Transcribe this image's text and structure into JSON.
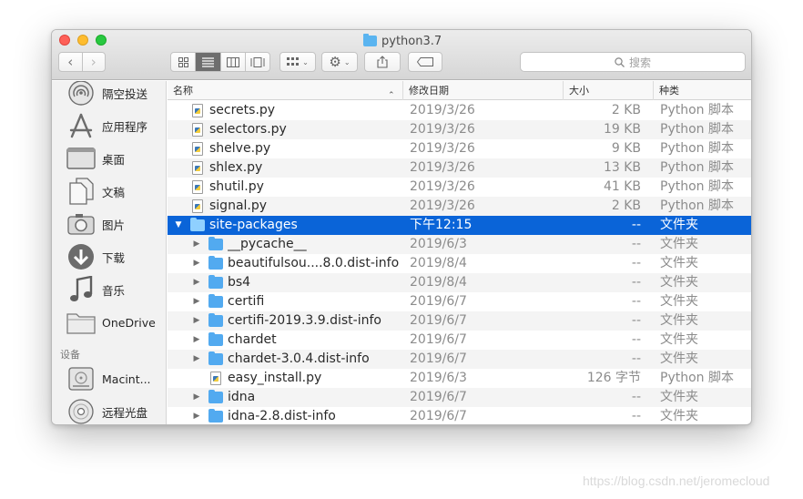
{
  "window": {
    "title": "python3.7"
  },
  "toolbar": {
    "back_glyph": "‹",
    "forward_glyph": "›",
    "search_placeholder": "搜索"
  },
  "sidebar": {
    "favorites": [
      {
        "label": "隔空投送",
        "icon": "airdrop-icon"
      },
      {
        "label": "应用程序",
        "icon": "applications-icon"
      },
      {
        "label": "桌面",
        "icon": "desktop-icon"
      },
      {
        "label": "文稿",
        "icon": "documents-icon"
      },
      {
        "label": "图片",
        "icon": "pictures-icon"
      },
      {
        "label": "下载",
        "icon": "downloads-icon"
      },
      {
        "label": "音乐",
        "icon": "music-icon"
      },
      {
        "label": "OneDrive",
        "icon": "folder-icon"
      }
    ],
    "devices_header": "设备",
    "devices": [
      {
        "label": "Macint...",
        "icon": "hard-drive-icon"
      },
      {
        "label": "远程光盘",
        "icon": "remote-disc-icon"
      }
    ]
  },
  "columns": {
    "name": "名称",
    "date": "修改日期",
    "size": "大小",
    "kind": "种类"
  },
  "files": [
    {
      "name": "secrets.py",
      "date": "2019/3/26",
      "size": "2 KB",
      "kind": "Python 脚本",
      "type": "py",
      "level": 0,
      "disclosure": ""
    },
    {
      "name": "selectors.py",
      "date": "2019/3/26",
      "size": "19 KB",
      "kind": "Python 脚本",
      "type": "py",
      "level": 0,
      "disclosure": ""
    },
    {
      "name": "shelve.py",
      "date": "2019/3/26",
      "size": "9 KB",
      "kind": "Python 脚本",
      "type": "py",
      "level": 0,
      "disclosure": ""
    },
    {
      "name": "shlex.py",
      "date": "2019/3/26",
      "size": "13 KB",
      "kind": "Python 脚本",
      "type": "py",
      "level": 0,
      "disclosure": ""
    },
    {
      "name": "shutil.py",
      "date": "2019/3/26",
      "size": "41 KB",
      "kind": "Python 脚本",
      "type": "py",
      "level": 0,
      "disclosure": ""
    },
    {
      "name": "signal.py",
      "date": "2019/3/26",
      "size": "2 KB",
      "kind": "Python 脚本",
      "type": "py",
      "level": 0,
      "disclosure": ""
    },
    {
      "name": "site-packages",
      "date": "下午12:15",
      "size": "--",
      "kind": "文件夹",
      "type": "folder",
      "level": 0,
      "disclosure": "▼",
      "selected": true
    },
    {
      "name": "__pycache__",
      "date": "2019/6/3",
      "size": "--",
      "kind": "文件夹",
      "type": "folder",
      "level": 1,
      "disclosure": "▶"
    },
    {
      "name": "beautifulsou....8.0.dist-info",
      "date": "2019/8/4",
      "size": "--",
      "kind": "文件夹",
      "type": "folder",
      "level": 1,
      "disclosure": "▶"
    },
    {
      "name": "bs4",
      "date": "2019/8/4",
      "size": "--",
      "kind": "文件夹",
      "type": "folder",
      "level": 1,
      "disclosure": "▶"
    },
    {
      "name": "certifi",
      "date": "2019/6/7",
      "size": "--",
      "kind": "文件夹",
      "type": "folder",
      "level": 1,
      "disclosure": "▶"
    },
    {
      "name": "certifi-2019.3.9.dist-info",
      "date": "2019/6/7",
      "size": "--",
      "kind": "文件夹",
      "type": "folder",
      "level": 1,
      "disclosure": "▶"
    },
    {
      "name": "chardet",
      "date": "2019/6/7",
      "size": "--",
      "kind": "文件夹",
      "type": "folder",
      "level": 1,
      "disclosure": "▶"
    },
    {
      "name": "chardet-3.0.4.dist-info",
      "date": "2019/6/7",
      "size": "--",
      "kind": "文件夹",
      "type": "folder",
      "level": 1,
      "disclosure": "▶"
    },
    {
      "name": "easy_install.py",
      "date": "2019/6/3",
      "size": "126 字节",
      "kind": "Python 脚本",
      "type": "py",
      "level": 1,
      "disclosure": ""
    },
    {
      "name": "idna",
      "date": "2019/6/7",
      "size": "--",
      "kind": "文件夹",
      "type": "folder",
      "level": 1,
      "disclosure": "▶"
    },
    {
      "name": "idna-2.8.dist-info",
      "date": "2019/6/7",
      "size": "--",
      "kind": "文件夹",
      "type": "folder",
      "level": 1,
      "disclosure": "▶"
    }
  ],
  "watermark": "https://blog.csdn.net/jeromecloud"
}
